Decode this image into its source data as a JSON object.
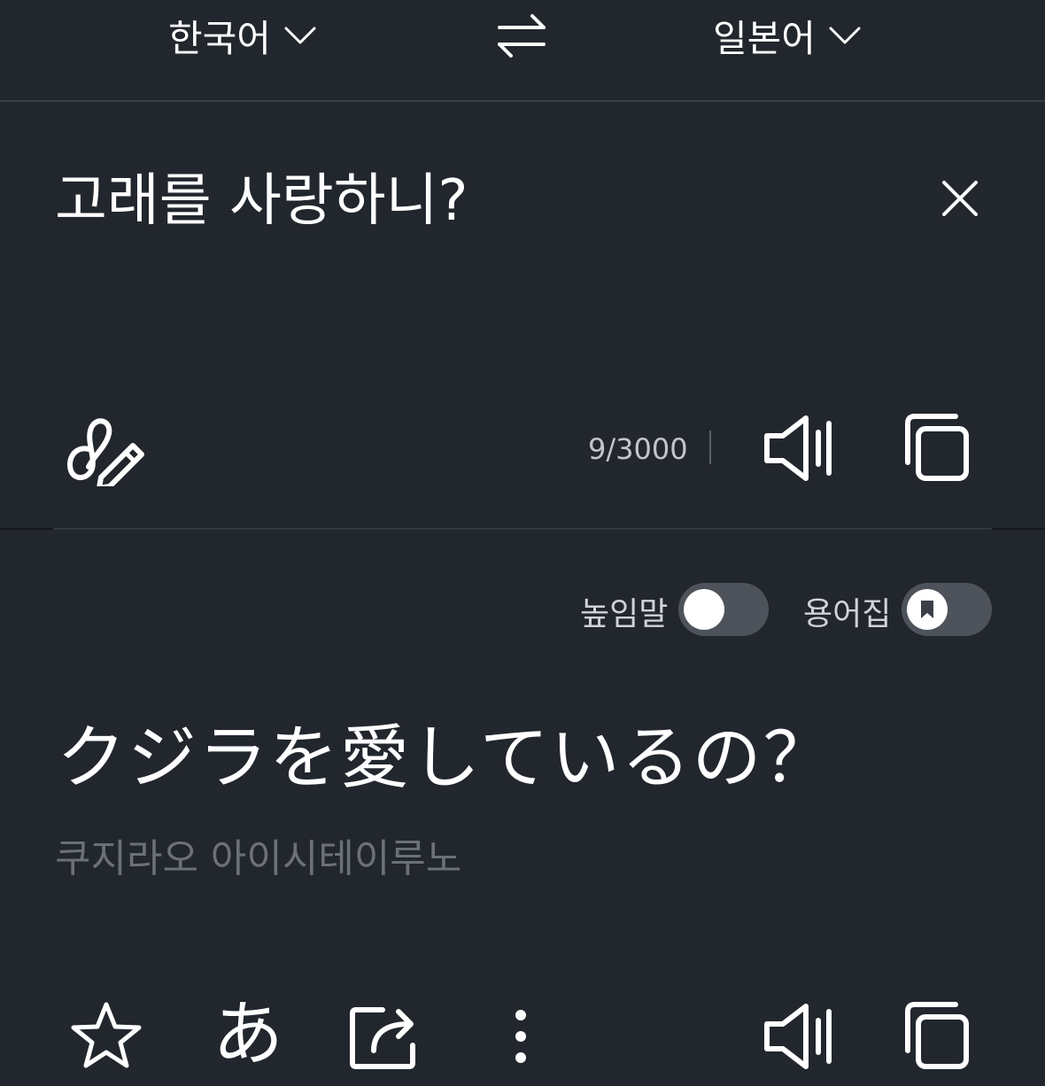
{
  "language_bar": {
    "source_language": "한국어",
    "target_language": "일본어"
  },
  "source": {
    "text": "고래를 사랑하니?",
    "char_count": "9/3000"
  },
  "options": {
    "honorific_label": "높임말",
    "honorific_on": false,
    "glossary_label": "용어집",
    "glossary_on": false
  },
  "result": {
    "text": "クジラを愛しているの？",
    "pronunciation": "쿠지라오 아이시테이루노",
    "hiragana_label": "あ"
  },
  "icons": [
    "chevron-down-icon",
    "swap-icon",
    "close-icon",
    "handwriting-icon",
    "speaker-icon",
    "copy-icon",
    "star-icon",
    "share-icon",
    "more-vertical-icon",
    "bookmark-icon"
  ],
  "colors": {
    "background": "#22262d",
    "text": "#ffffff",
    "muted_text": "#6c7079",
    "toggle_track": "#4e535b"
  }
}
